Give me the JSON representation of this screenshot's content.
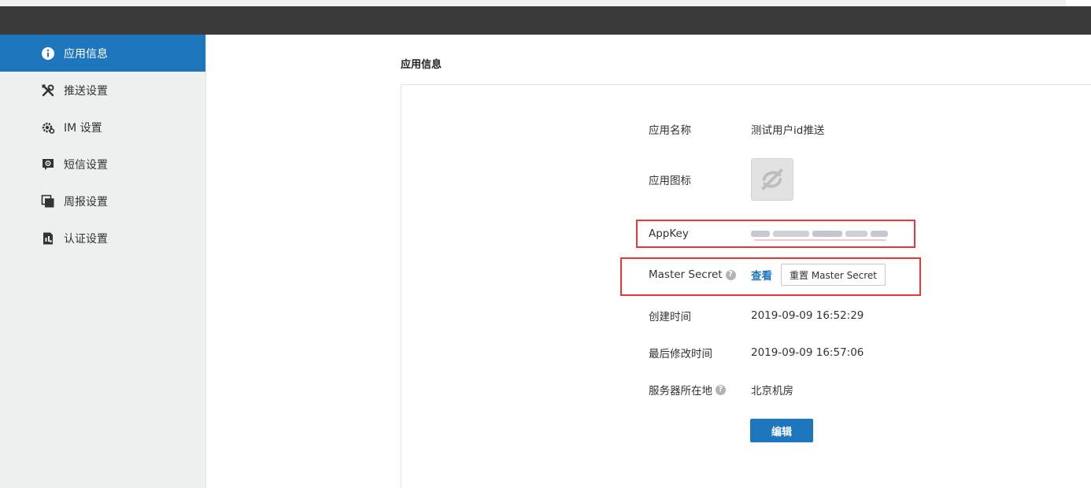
{
  "sidebar": {
    "items": [
      {
        "label": "应用信息",
        "icon": "info-icon",
        "active": true
      },
      {
        "label": "推送设置",
        "icon": "tools-icon"
      },
      {
        "label": "IM 设置",
        "icon": "gear-icon"
      },
      {
        "label": "短信设置",
        "icon": "sms-icon"
      },
      {
        "label": "周报设置",
        "icon": "pages-icon"
      },
      {
        "label": "认证设置",
        "icon": "certificate-icon"
      }
    ]
  },
  "main": {
    "title": "应用信息",
    "fields": {
      "app_name": {
        "label": "应用名称",
        "value": "测试用户id推送"
      },
      "app_icon": {
        "label": "应用图标",
        "icon": "app-placeholder-icon"
      },
      "app_key": {
        "label": "AppKey",
        "value_note": "blurred"
      },
      "master_secret": {
        "label": "Master Secret",
        "help": "?",
        "view_label": "查看",
        "reset_label": "重置 Master Secret"
      },
      "created_at": {
        "label": "创建时间",
        "value": "2019-09-09 16:52:29"
      },
      "modified_at": {
        "label": "最后修改时间",
        "value": "2019-09-09 16:57:06"
      },
      "server_location": {
        "label": "服务器所在地",
        "help": "?",
        "value": "北京机房"
      }
    },
    "edit_label": "编辑"
  },
  "colors": {
    "accent": "#1e76bd",
    "topbar": "#3a3a3a",
    "sidebar_bg": "#eef0f0",
    "highlight": "#e8363b"
  }
}
